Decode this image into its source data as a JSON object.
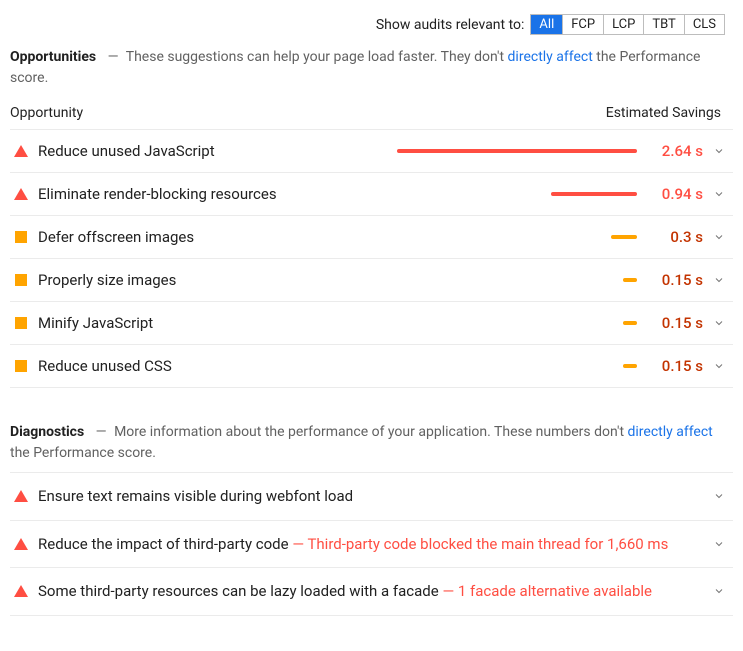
{
  "filter": {
    "label": "Show audits relevant to:",
    "chips": [
      "All",
      "FCP",
      "LCP",
      "TBT",
      "CLS"
    ],
    "activeIndex": 0
  },
  "opportunities": {
    "title": "Opportunities",
    "desc_before": "These suggestions can help your page load faster. They don't ",
    "desc_link": "directly affect",
    "desc_after": " the Performance score.",
    "col_opportunity": "Opportunity",
    "col_savings": "Estimated Savings",
    "items": [
      {
        "severity": "red",
        "label": "Reduce unused JavaScript",
        "time": "2.64 s",
        "barPct": 100,
        "barColor": "red"
      },
      {
        "severity": "red",
        "label": "Eliminate render-blocking resources",
        "time": "0.94 s",
        "barPct": 36,
        "barColor": "red"
      },
      {
        "severity": "orange",
        "label": "Defer offscreen images",
        "time": "0.3 s",
        "barPct": 11,
        "barColor": "orange"
      },
      {
        "severity": "orange",
        "label": "Properly size images",
        "time": "0.15 s",
        "barPct": 6,
        "barColor": "orange"
      },
      {
        "severity": "orange",
        "label": "Minify JavaScript",
        "time": "0.15 s",
        "barPct": 6,
        "barColor": "orange"
      },
      {
        "severity": "orange",
        "label": "Reduce unused CSS",
        "time": "0.15 s",
        "barPct": 6,
        "barColor": "orange"
      }
    ]
  },
  "diagnostics": {
    "title": "Diagnostics",
    "desc_before": "More information about the performance of your application. These numbers don't ",
    "desc_link": "directly affect",
    "desc_after": " the Performance score.",
    "items": [
      {
        "severity": "red",
        "label": "Ensure text remains visible during webfont load",
        "warn": ""
      },
      {
        "severity": "red",
        "label": "Reduce the impact of third-party code",
        "warn": "Third-party code blocked the main thread for 1,660 ms"
      },
      {
        "severity": "red",
        "label": "Some third-party resources can be lazy loaded with a facade",
        "warn": "1 facade alternative available"
      }
    ]
  }
}
